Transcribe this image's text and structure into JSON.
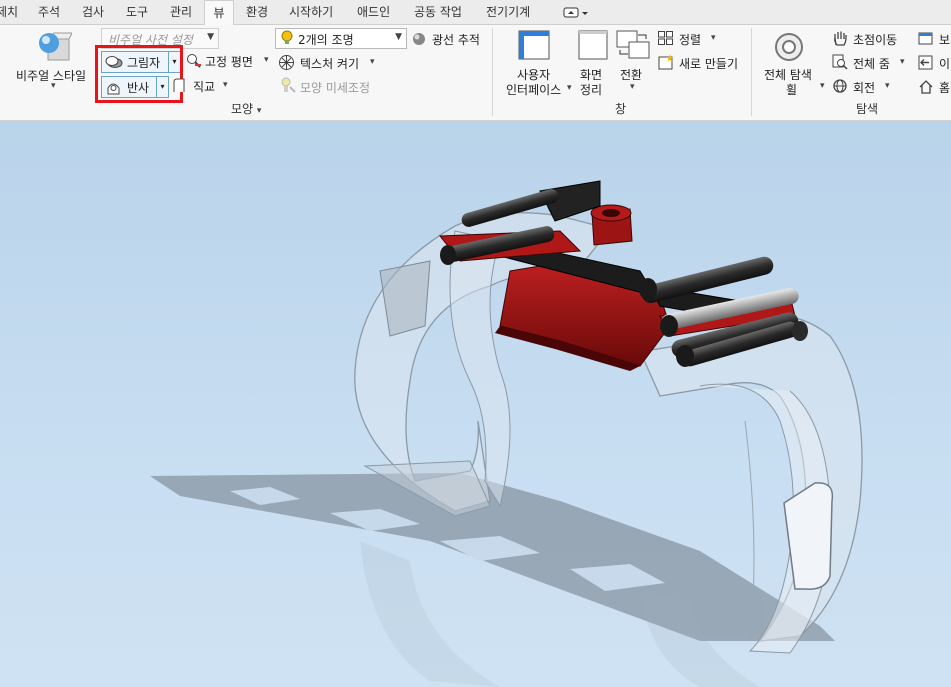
{
  "tabs": [
    {
      "label": "제치",
      "active": false
    },
    {
      "label": "주석",
      "active": false
    },
    {
      "label": "검사",
      "active": false
    },
    {
      "label": "도구",
      "active": false
    },
    {
      "label": "관리",
      "active": false
    },
    {
      "label": "뷰",
      "active": true
    },
    {
      "label": "환경",
      "active": false
    },
    {
      "label": "시작하기",
      "active": false
    },
    {
      "label": "애드인",
      "active": false
    },
    {
      "label": "공동 작업",
      "active": false
    },
    {
      "label": "전기기계",
      "active": false
    }
  ],
  "ribbon": {
    "appearance": {
      "visual_style": "비주얼 스타일",
      "shadow": "그림자",
      "reflection": "반사",
      "visual_preset_placeholder": "비주얼 사전 설정",
      "ground_plane": "고정 평면",
      "orthographic": "직교",
      "lighting": "2개의 조명",
      "ray_tracing": "광선 추적",
      "texture_on": "텍스처 켜기",
      "appearance_tweak": "모양 미세조정",
      "panel_title": "모양"
    },
    "windows": {
      "user_interface_line1": "사용자",
      "user_interface_line2": "인터페이스",
      "clean_screen_line1": "화면",
      "clean_screen_line2": "정리",
      "switch": "전환",
      "arrange": "정렬",
      "new_window": "새로 만들기",
      "panel_title": "창"
    },
    "navigate": {
      "full_nav_line1": "전체 탐색",
      "full_nav_line2": "휠",
      "pan": "초점이동",
      "zoom_all": "전체 줌",
      "orbit": "회전",
      "look_at": "보",
      "previous": "이",
      "home": "홈",
      "panel_title": "탐색"
    }
  },
  "highlight_color": "#e8141c",
  "part_color": "#8e0f0f",
  "pin_color": "#2a2a2a",
  "background_color": "#c5dcf0"
}
